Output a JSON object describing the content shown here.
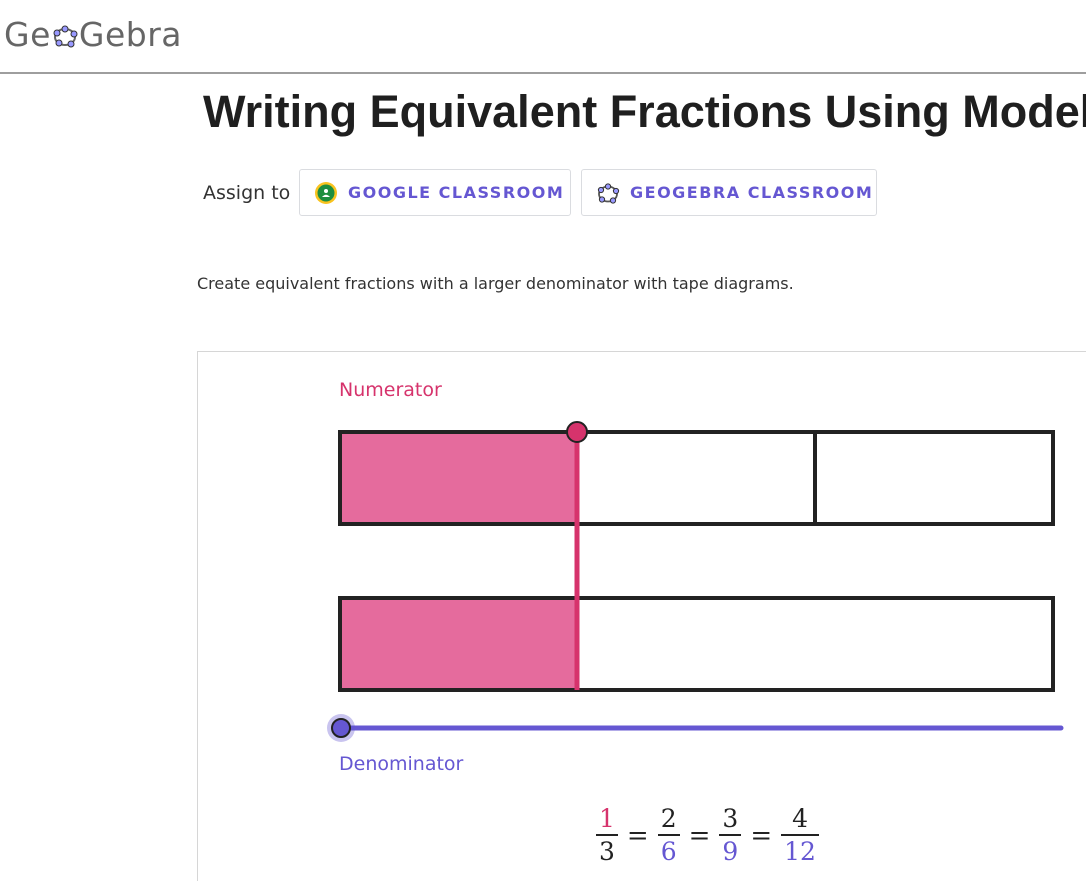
{
  "header": {
    "logo_text_left": "Ge",
    "logo_text_right": "Gebra"
  },
  "page": {
    "title": "Writing Equivalent Fractions Using Models",
    "assign_label": "Assign to",
    "google_classroom_label": "GOOGLE CLASSROOM",
    "geogebra_classroom_label": "GEOGEBRA CLASSROOM",
    "description": "Create equivalent fractions with a larger denominator with tape diagrams."
  },
  "applet": {
    "numerator_label": "Numerator",
    "denominator_label": "Denominator",
    "numerator_value": 1,
    "denominator_value": 3,
    "top_tape_parts": 3,
    "bottom_tape_parts": 1,
    "denominator_slider_position": 0,
    "equation": [
      {
        "num": "1",
        "den": "3"
      },
      {
        "num": "2",
        "den": "6"
      },
      {
        "num": "3",
        "den": "9"
      },
      {
        "num": "4",
        "den": "12"
      }
    ],
    "equals": "="
  },
  "colors": {
    "pink": "#d6336c",
    "pink_fill": "#e56b9d",
    "purple": "#6557d2",
    "logo_gray": "#666666"
  }
}
